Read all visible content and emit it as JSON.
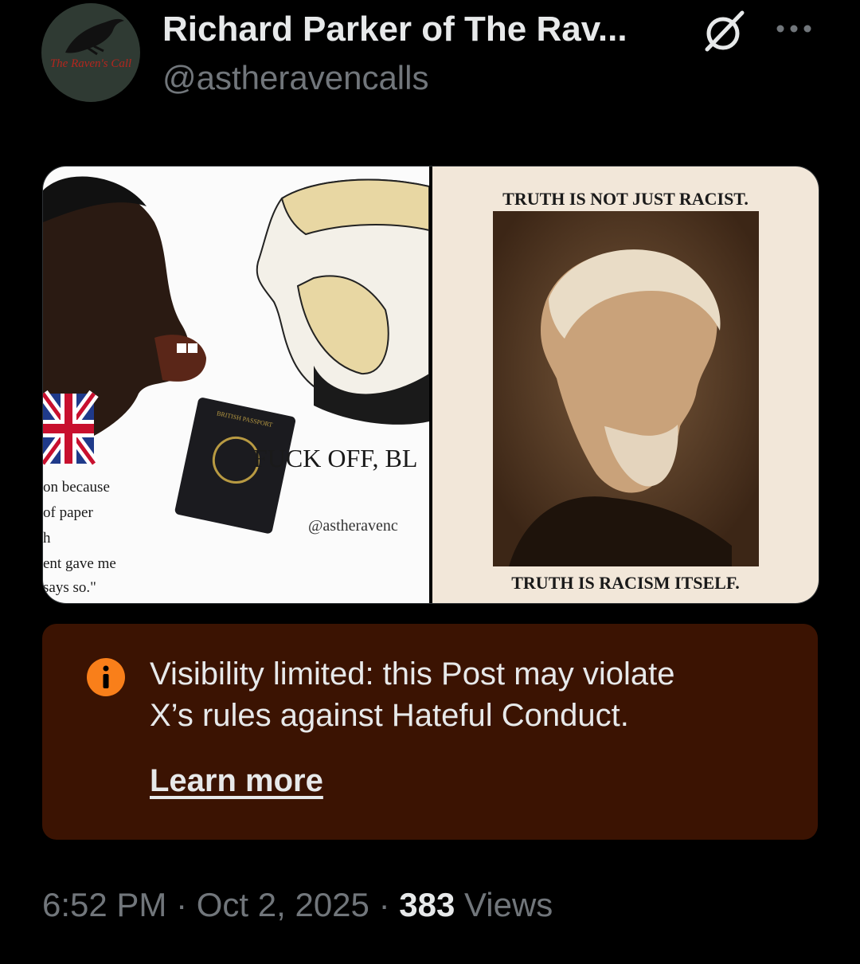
{
  "post": {
    "display_name": "Richard Parker of The Rav...",
    "handle": "@astheravencalls",
    "avatar_text": "The Raven's Call",
    "time": "6:52 PM",
    "date": "Oct 2, 2025",
    "separator": "·",
    "views_count": "383",
    "views_label": "Views"
  },
  "media": {
    "left": {
      "headline": "FUCK OFF, BL",
      "watermark": "@astheravenc",
      "passport_text": "BRITISH PASSPORT",
      "caption_lines": [
        "on because",
        "of paper",
        "h",
        "ent gave me",
        "says so.\""
      ]
    },
    "right": {
      "top_text": "TRUTH IS NOT JUST RACIST.",
      "bottom_text": "TRUTH IS RACISM ITSELF."
    }
  },
  "notice": {
    "line1": "Visibility limited: this Post may violate",
    "line2": "X’s rules against Hateful Conduct.",
    "learn_more": "Learn more"
  },
  "colors": {
    "background": "#000000",
    "notice_bg": "#3b1302",
    "info_icon": "#f97f1a",
    "secondary_text": "#71767b"
  }
}
